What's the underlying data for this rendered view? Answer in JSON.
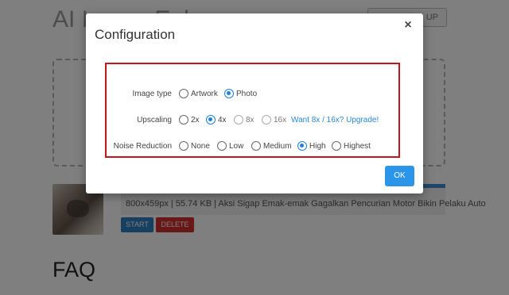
{
  "background": {
    "title": "AI Image Enlarger",
    "signup_label": "SIGN UP",
    "file": {
      "info": "800x459px | 55.74 KB | Aksi Sigap Emak-emak Gagalkan Pencurian Motor Bikin Pelaku Auto",
      "start_label": "START",
      "delete_label": "DELETE"
    },
    "faq_heading": "FAQ"
  },
  "modal": {
    "title": "Configuration",
    "close_label": "×",
    "image_type": {
      "label": "Image type",
      "options": [
        {
          "label": "Artwork",
          "selected": false
        },
        {
          "label": "Photo",
          "selected": true
        }
      ]
    },
    "upscaling": {
      "label": "Upscaling",
      "options": [
        {
          "label": "2x",
          "selected": false
        },
        {
          "label": "4x",
          "selected": true
        },
        {
          "label": "8x",
          "selected": false
        },
        {
          "label": "16x",
          "selected": false
        }
      ],
      "upgrade_link": "Want 8x / 16x? Upgrade!"
    },
    "noise_reduction": {
      "label": "Noise Reduction",
      "options": [
        {
          "label": "None",
          "selected": false
        },
        {
          "label": "Low",
          "selected": false
        },
        {
          "label": "Medium",
          "selected": false
        },
        {
          "label": "High",
          "selected": true
        },
        {
          "label": "Highest",
          "selected": false
        }
      ]
    },
    "ok_label": "OK"
  },
  "colors": {
    "accent": "#1f7fd6",
    "highlight_border": "#c0171c",
    "ok_button": "#2b95e9",
    "start_button": "#2f7fc1",
    "delete_button": "#d32f2f"
  }
}
